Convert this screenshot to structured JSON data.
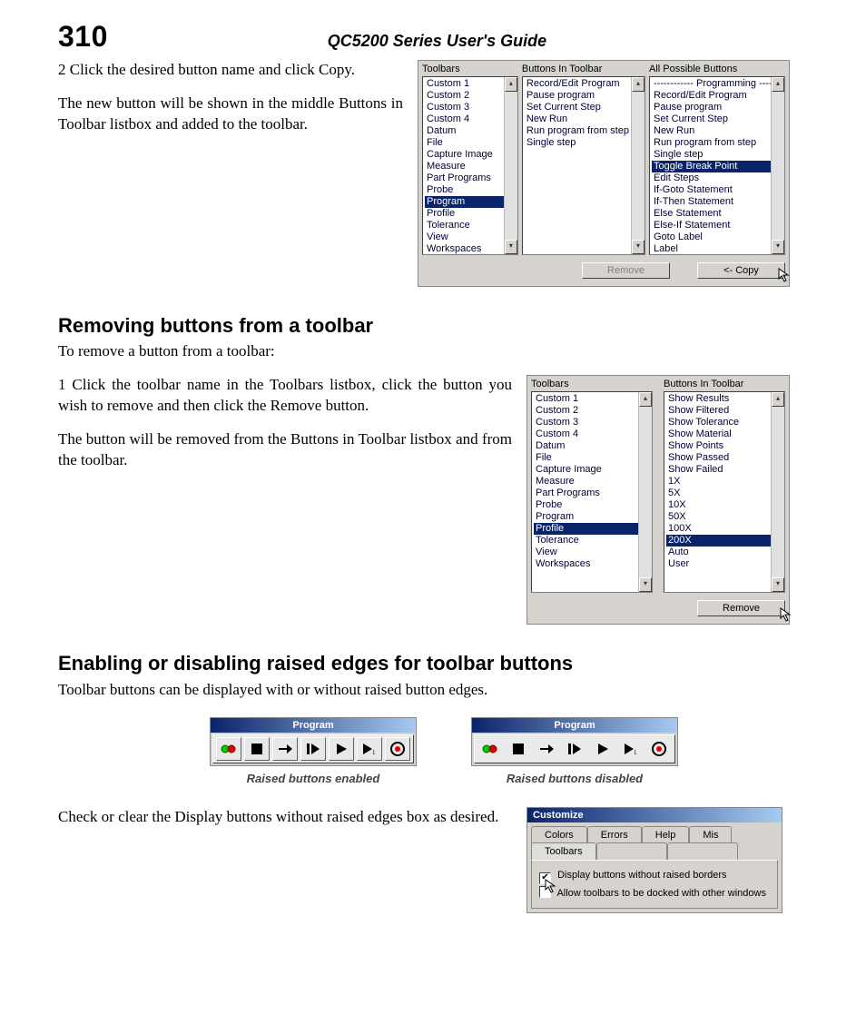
{
  "page_number": "310",
  "guide_title": "QC5200 Series User's Guide",
  "step2_line": "2   Click the desired button name and click Copy.",
  "step2_result": "The new button will be shown in the middle Buttons in Toolbar listbox and added to the toolbar.",
  "panel1": {
    "heads": {
      "toolbars": "Toolbars",
      "bit": "Buttons In Toolbar",
      "apb": "All Possible Buttons"
    },
    "toolbars": [
      "Custom 1",
      "Custom 2",
      "Custom 3",
      "Custom 4",
      "Datum",
      "File",
      "Capture Image",
      "Measure",
      "Part Programs",
      "Probe",
      "Program",
      "Profile",
      "Tolerance",
      "View",
      "Workspaces"
    ],
    "toolbars_sel": 10,
    "bit": [
      "Record/Edit Program",
      "Pause program",
      "Set Current Step",
      "New Run",
      "Run program from step",
      "Single step"
    ],
    "apb_header": "------------ Programming ------------",
    "apb": [
      "Record/Edit Program",
      "Pause program",
      "Set Current Step",
      "New Run",
      "Run program from step",
      "Single step",
      "Toggle Break Point",
      "Edit Steps",
      "If-Goto Statement",
      "If-Then Statement",
      "Else Statement",
      "Else-If Statement",
      "Goto Label",
      "Label"
    ],
    "apb_sel": 6,
    "buttons": {
      "remove": "Remove",
      "copy": "<- Copy"
    }
  },
  "h_remove": "Removing buttons from a toolbar",
  "remove_intro": "To remove a button from a toolbar:",
  "remove_step1": "1   Click the toolbar name in the Toolbars listbox, click the button you wish to remove and then click the Remove button.",
  "remove_result": "The button will be removed from the Buttons in Toolbar listbox and from the toolbar.",
  "panel2": {
    "heads": {
      "toolbars": "Toolbars",
      "bit": "Buttons In Toolbar"
    },
    "toolbars": [
      "Custom 1",
      "Custom 2",
      "Custom 3",
      "Custom 4",
      "Datum",
      "File",
      "Capture Image",
      "Measure",
      "Part Programs",
      "Probe",
      "Program",
      "Profile",
      "Tolerance",
      "View",
      "Workspaces"
    ],
    "toolbars_sel": 11,
    "bit": [
      "Show Results",
      "Show Filtered",
      "Show Tolerance",
      "Show Material",
      "Show Points",
      "Show Passed",
      "Show Failed",
      "1X",
      "5X",
      "10X",
      "50X",
      "100X",
      "200X",
      "Auto",
      "User"
    ],
    "bit_sel": 12,
    "buttons": {
      "remove": "Remove"
    }
  },
  "h_raised": "Enabling or disabling raised edges for toolbar buttons",
  "raised_intro": "Toolbar buttons can be displayed with or without raised button edges.",
  "raised_cap1": "Raised buttons enabled",
  "raised_cap2": "Raised buttons disabled",
  "tbwin_title": "Program",
  "raised_check_text": "Check or clear the Display buttons without raised edges box as desired.",
  "customize": {
    "title": "Customize",
    "tabs": [
      "Colors",
      "Errors",
      "Help",
      "Mis"
    ],
    "tab_toolbars": "Toolbars",
    "chk1": "Display buttons without raised borders",
    "chk2": "Allow toolbars to be docked with other windows"
  }
}
